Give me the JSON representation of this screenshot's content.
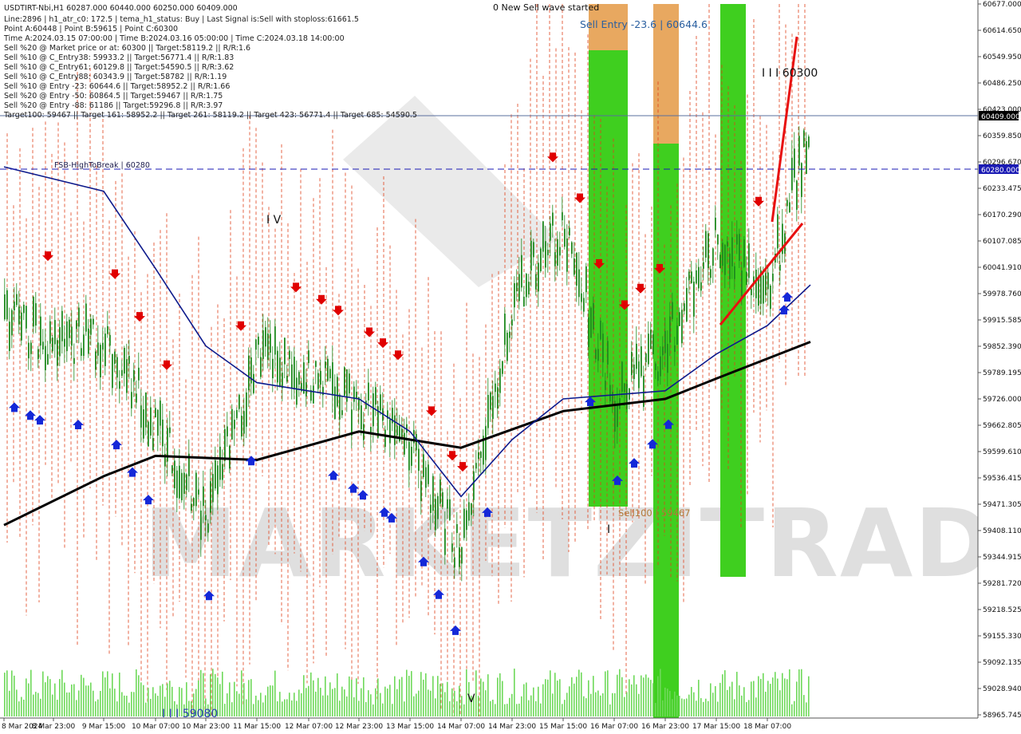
{
  "header": {
    "lines": [
      "USDTIRT-Nbi,H1  60287.000 60440.000 60250.000 60409.000",
      "Line:2896  |  h1_atr_c0: 172.5  |  tema_h1_status: Buy  |  Last Signal is:Sell with stoploss:61661.5",
      "Point A:60448  |  Point B:59615  |  Point C:60300",
      "Time A:2024.03.15 07:00:00  |  Time B:2024.03.16 05:00:00  |  Time C:2024.03.18 14:00:00",
      "Sell %20 @ Market price or at: 60300  ||  Target:58119.2  ||  R/R:1.6",
      "Sell %10 @ C_Entry38: 59933.2  ||  Target:56771.4  ||  R/R:1.83",
      "Sell %10 @ C_Entry61: 60129.8  ||  Target:54590.5  ||  R/R:3.62",
      "Sell %10 @ C_Entry88: 60343.9  ||  Target:58782  ||  R/R:1.19",
      "Sell %10 @ Entry -23: 60644.6  ||  Target:58952.2  ||  R/R:1.66",
      "Sell %20 @ Entry -50: 60864.5  ||  Target:59467  ||  R/R:1.75",
      "Sell %20 @ Entry -88: 61186  ||  Target:59296.8  ||  R/R:3.97",
      "Target100: 59467  ||  Target 161: 58952.2  ||  Target 261: 58119.2  ||  Target 423: 56771.4  ||  Target 685: 54590.5"
    ]
  },
  "annotations": {
    "wave_status": "0 New Sell wave started",
    "sell_entry": "Sell Entry -23.6 | 60644.6",
    "fsb_label": "FSB-HighToBreak | 60280",
    "sell100": "Sell100 | 59467",
    "wave_iii": "I I I 60300",
    "wave_iv": "I V",
    "wave_i": "I",
    "wave_v": "V",
    "wave_bottom": "I I I 59080",
    "watermark": "MARKETZITRADE"
  },
  "price_axis": {
    "ticks": [
      "60677.000",
      "60614.650",
      "60549.950",
      "60486.250",
      "60423.000",
      "60359.850",
      "60296.670",
      "60233.475",
      "60170.290",
      "60107.085",
      "60041.910",
      "59978.760",
      "59915.585",
      "59852.390",
      "59789.195",
      "59726.000",
      "59662.805",
      "59599.610",
      "59536.415",
      "59471.305",
      "59408.110",
      "59344.915",
      "59281.720",
      "59218.525",
      "59155.330",
      "59092.135",
      "59028.940",
      "58965.745"
    ],
    "current_price": "60409.000",
    "fsb_price": "60280.000"
  },
  "time_axis": {
    "labels": [
      "8 Mar 2024",
      "8 Mar 23:00",
      "9 Mar 15:00",
      "10 Mar 07:00",
      "10 Mar 23:00",
      "11 Mar 15:00",
      "12 Mar 07:00",
      "12 Mar 23:00",
      "13 Mar 15:00",
      "14 Mar 07:00",
      "14 Mar 23:00",
      "15 Mar 15:00",
      "16 Mar 07:00",
      "16 Mar 23:00",
      "17 Mar 15:00",
      "18 Mar 07:00"
    ]
  },
  "colors": {
    "background": "#ffffff",
    "candle": "#1f8a1f",
    "blue_ma": "#0d1a8c",
    "black_ma": "#000000",
    "orange_dashed": "#e0401a",
    "fsb_line": "#1a1ab4",
    "current_line": "#5a6f9e",
    "green_zone": "#3fcf1f",
    "orange_zone": "#e8a860",
    "sell_arrow": "#e00000",
    "buy_arrow": "#1428d8",
    "trend_red": "#e81010",
    "volume": "#6fd95a"
  },
  "chart_data": {
    "type": "candlestick",
    "title": "USDTIRT-Nbi,H1",
    "x_range": [
      "2024-03-08",
      "2024-03-18"
    ],
    "ylim": [
      58940,
      60690
    ],
    "grid": false,
    "levels": {
      "fsb_high_to_break": 60280,
      "current_price": 60409,
      "sell_entry": 60644.6,
      "sell100": 59467,
      "wave_iii": 60300,
      "wave_bottom": 59080
    },
    "close_path": [
      {
        "t": "8 Mar 2024",
        "y": 59920
      },
      {
        "t": "8 Mar 23:00",
        "y": 59860
      },
      {
        "t": "9 Mar 15:00",
        "y": 59870
      },
      {
        "t": "10 Mar 07:00",
        "y": 59650
      },
      {
        "t": "10 Mar 23:00",
        "y": 59420
      },
      {
        "t": "11 Mar 15:00",
        "y": 59820
      },
      {
        "t": "12 Mar 07:00",
        "y": 59780
      },
      {
        "t": "12 Mar 23:00",
        "y": 59700
      },
      {
        "t": "13 Mar 15:00",
        "y": 59600
      },
      {
        "t": "14 Mar 07:00",
        "y": 59330
      },
      {
        "t": "14 Mar 23:00",
        "y": 59950
      },
      {
        "t": "15 Mar 15:00",
        "y": 60150
      },
      {
        "t": "16 Mar 07:00",
        "y": 59720
      },
      {
        "t": "16 Mar 23:00",
        "y": 59850
      },
      {
        "t": "17 Mar 15:00",
        "y": 60100
      },
      {
        "t": "18 Mar 07:00",
        "y": 59980
      },
      {
        "t": "18 Mar 14:00",
        "y": 60409
      }
    ],
    "blue_ma": [
      {
        "t": "8 Mar 2024",
        "y": 60290
      },
      {
        "t": "9 Mar 15:00",
        "y": 60230
      },
      {
        "t": "10 Mar 07:00",
        "y": 60040
      },
      {
        "t": "10 Mar 23:00",
        "y": 59850
      },
      {
        "t": "11 Mar 15:00",
        "y": 59760
      },
      {
        "t": "12 Mar 23:00",
        "y": 59720
      },
      {
        "t": "13 Mar 15:00",
        "y": 59640
      },
      {
        "t": "14 Mar 07:00",
        "y": 59480
      },
      {
        "t": "14 Mar 23:00",
        "y": 59620
      },
      {
        "t": "15 Mar 15:00",
        "y": 59720
      },
      {
        "t": "16 Mar 23:00",
        "y": 59740
      },
      {
        "t": "17 Mar 15:00",
        "y": 59830
      },
      {
        "t": "18 Mar 07:00",
        "y": 59900
      },
      {
        "t": "18 Mar 14:00",
        "y": 60000
      }
    ],
    "black_ma": [
      {
        "t": "8 Mar 2024",
        "y": 59410
      },
      {
        "t": "9 Mar 15:00",
        "y": 59530
      },
      {
        "t": "10 Mar 07:00",
        "y": 59580
      },
      {
        "t": "11 Mar 15:00",
        "y": 59570
      },
      {
        "t": "12 Mar 23:00",
        "y": 59640
      },
      {
        "t": "14 Mar 07:00",
        "y": 59600
      },
      {
        "t": "15 Mar 15:00",
        "y": 59690
      },
      {
        "t": "16 Mar 23:00",
        "y": 59720
      },
      {
        "t": "17 Mar 15:00",
        "y": 59770
      },
      {
        "t": "18 Mar 14:00",
        "y": 59860
      }
    ]
  }
}
